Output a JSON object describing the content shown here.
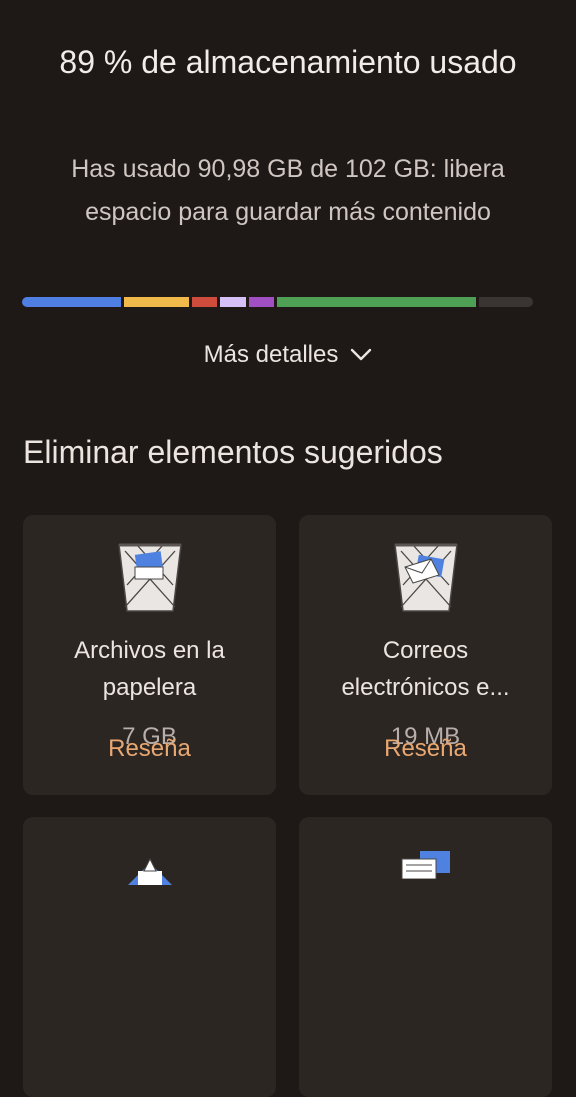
{
  "header": {
    "title": "89 % de almacenamiento usado",
    "subtitle": "Has usado 90,98 GB de 102 GB: libera espacio para guardar más contenido"
  },
  "storage_bar": {
    "segments": [
      {
        "color": "#4f7fe3",
        "fraction": 0.195
      },
      {
        "color": "#f0b94a",
        "fraction": 0.128
      },
      {
        "color": "#cf4c3c",
        "fraction": 0.05
      },
      {
        "color": "#d7c0f5",
        "fraction": 0.05
      },
      {
        "color": "#a14fc2",
        "fraction": 0.05
      },
      {
        "color": "#4ea154",
        "fraction": 0.392
      },
      {
        "color": "#3a3532",
        "fraction": 0.105
      }
    ]
  },
  "details": {
    "label": "Más detalles",
    "icon": "chevron-down-icon"
  },
  "suggestions": {
    "title": "Eliminar elementos sugeridos",
    "cards": [
      {
        "line1": "Archivos en la",
        "line2": "papelera",
        "size": "7 GB",
        "action": "Reseña"
      },
      {
        "line1": "Correos",
        "line2": "electrónicos e...",
        "size": "19 MB",
        "action": "Reseña"
      }
    ]
  }
}
